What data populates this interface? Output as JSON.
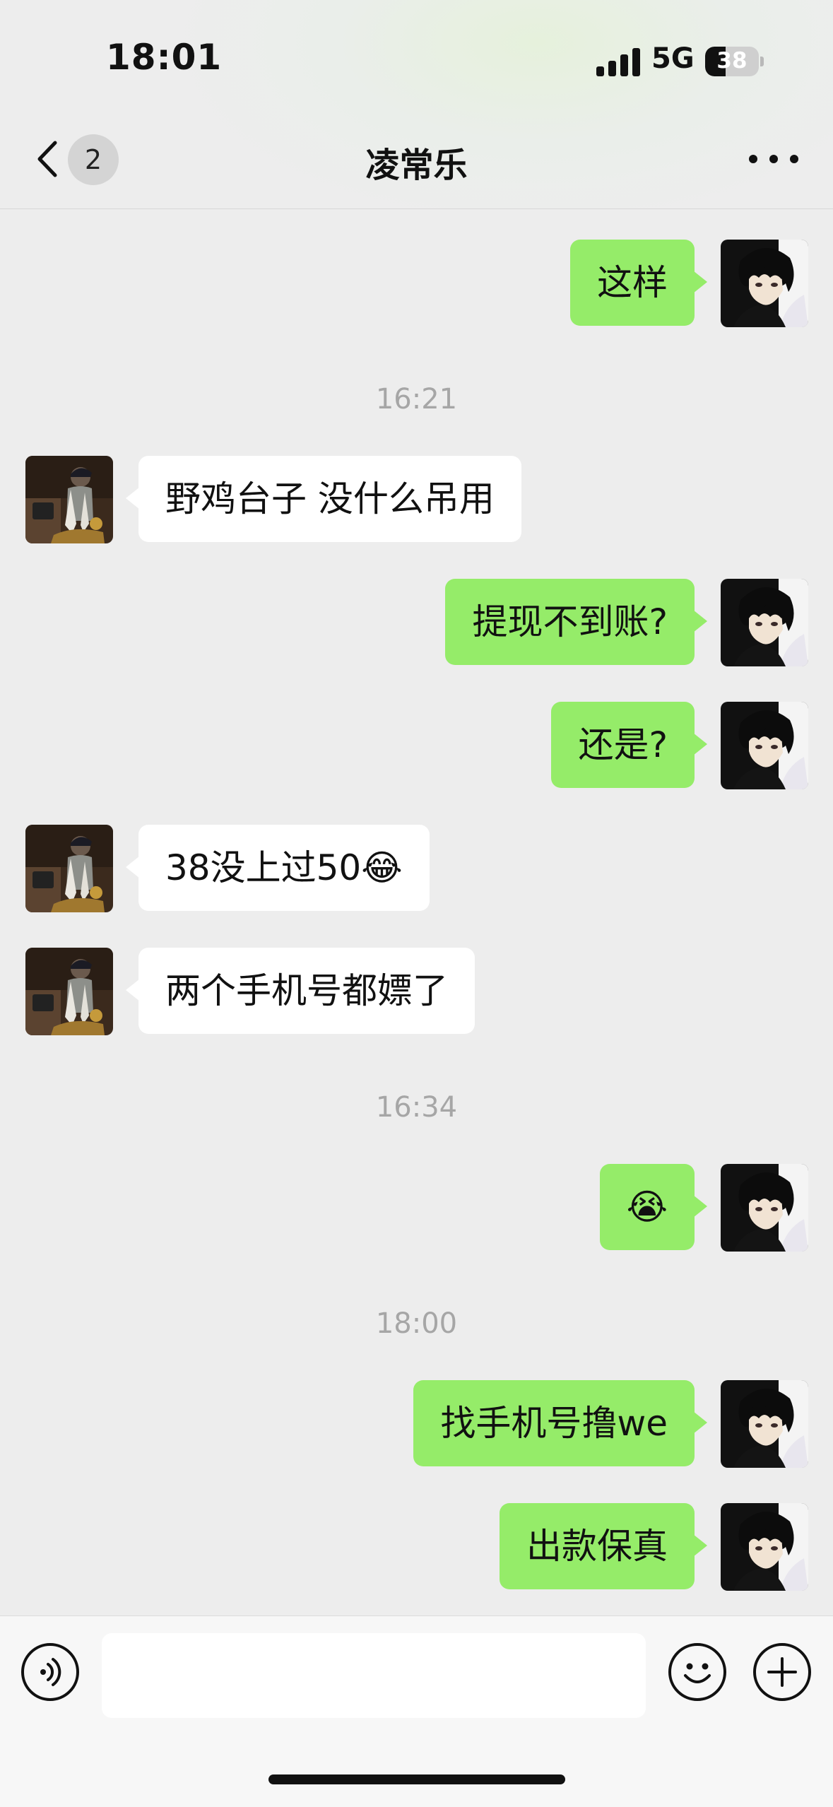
{
  "status_bar": {
    "time": "18:01",
    "network": "5G",
    "battery": "38",
    "battery_level": 0.38
  },
  "header": {
    "unread_count": "2",
    "title": "凌常乐"
  },
  "messages": [
    {
      "side": "out",
      "text": "这样"
    },
    {
      "timestamp": "16:21"
    },
    {
      "side": "in",
      "text": "野鸡台子 没什么吊用"
    },
    {
      "side": "out",
      "text": "提现不到账?"
    },
    {
      "side": "out",
      "text": "还是?"
    },
    {
      "side": "in",
      "text": "38没上过50😂"
    },
    {
      "side": "in",
      "text": "两个手机号都嫖了"
    },
    {
      "timestamp": "16:34"
    },
    {
      "side": "out",
      "text": "😭"
    },
    {
      "timestamp": "18:00"
    },
    {
      "side": "out",
      "text": "找手机号撸we"
    },
    {
      "side": "out",
      "text": "出款保真"
    }
  ],
  "colors": {
    "outgoing_bubble": "#95ec69",
    "incoming_bubble": "#ffffff",
    "background": "#ededed"
  },
  "icons": {
    "back": "chevron-left-icon",
    "more": "more-dots-icon",
    "voice": "voice-icon",
    "emoji": "emoji-icon",
    "plus": "plus-icon"
  }
}
